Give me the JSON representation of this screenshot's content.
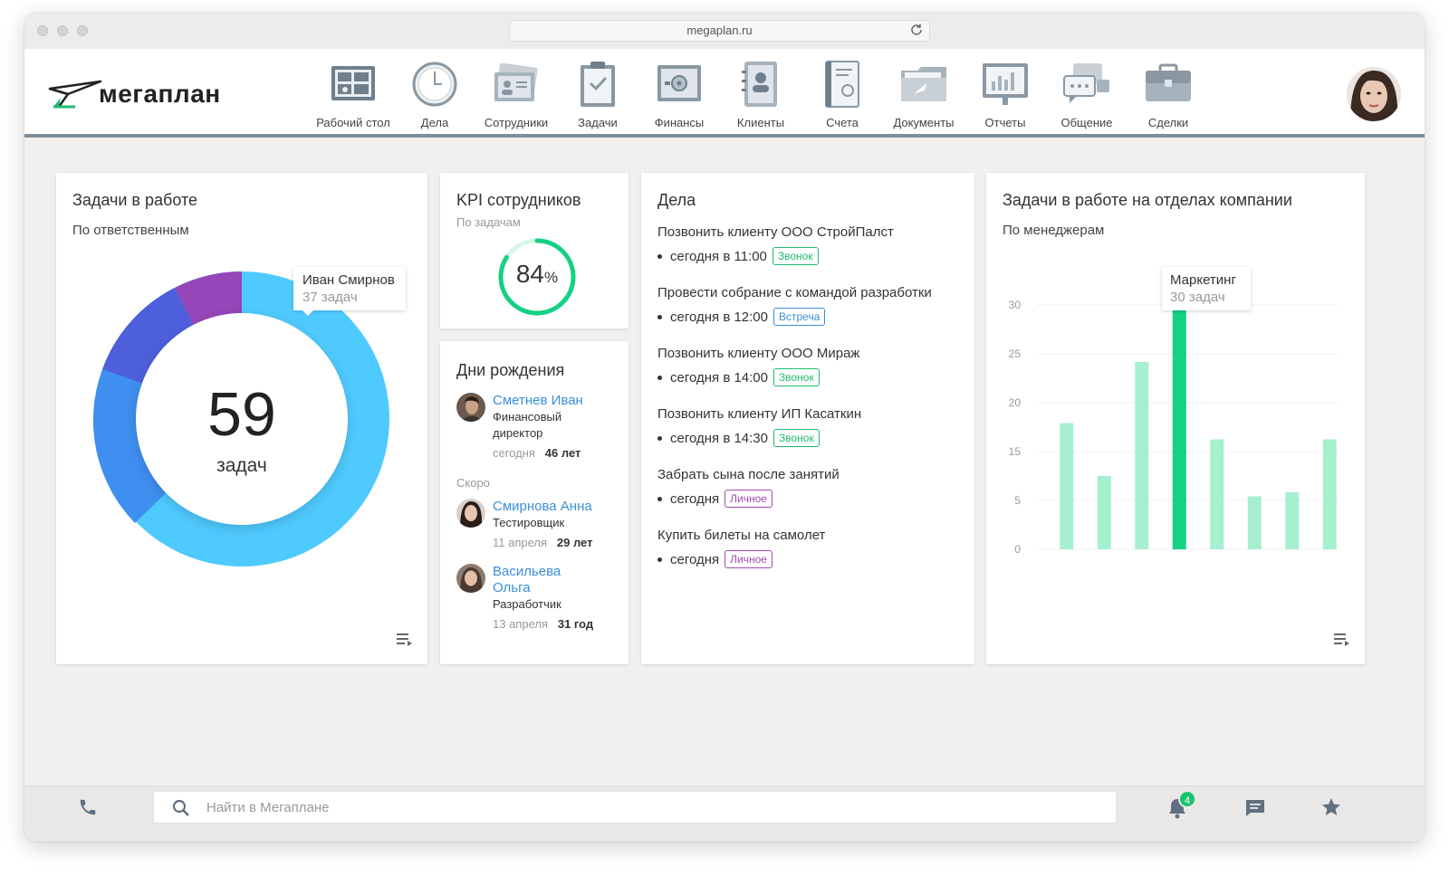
{
  "browser": {
    "url": "megaplan.ru"
  },
  "app": {
    "logo_text": "мегаплан",
    "nav": [
      {
        "label": "Рабочий стол",
        "icon": "desktop-icon"
      },
      {
        "label": "Дела",
        "icon": "clock-icon"
      },
      {
        "label": "Сотрудники",
        "icon": "employees-icon"
      },
      {
        "label": "Задачи",
        "icon": "clipboard-icon"
      },
      {
        "label": "Финансы",
        "icon": "safe-icon"
      },
      {
        "label": "Клиенты",
        "icon": "contacts-icon"
      },
      {
        "label": "Счета",
        "icon": "invoice-icon"
      },
      {
        "label": "Документы",
        "icon": "folder-icon"
      },
      {
        "label": "Отчеты",
        "icon": "report-icon"
      },
      {
        "label": "Общение",
        "icon": "chat-icon"
      },
      {
        "label": "Сделки",
        "icon": "briefcase-icon"
      }
    ]
  },
  "tasks_card": {
    "title": "Задачи в работе",
    "subtitle": "По ответственным",
    "total_value": "59",
    "total_unit": "задач",
    "tooltip_name": "Иван Смирнов",
    "tooltip_value": "37 задач",
    "segment_colors": [
      "#4fcaff",
      "#3f8ff0",
      "#4d5fdb",
      "#9546b8"
    ]
  },
  "kpi_card": {
    "title": "KPI сотрудников",
    "subtitle": "По задачам",
    "value": "84",
    "unit": "%",
    "fraction": 0.84
  },
  "birthdays": {
    "title": "Дни рождения",
    "soon_label": "Скоро",
    "people": [
      {
        "name": "Сметнев Иван",
        "role1": "Финансовый",
        "role2": "директор",
        "date": "сегодня",
        "age": "46 лет"
      },
      {
        "name": "Смирнова Анна",
        "role1": "Тестировщик",
        "role2": "",
        "date": "11 апреля",
        "age": "29 лет"
      },
      {
        "name": "Васильева",
        "name2": "Ольга",
        "role1": "Разработчик",
        "role2": "",
        "date": "13 апреля",
        "age": "31 год"
      }
    ]
  },
  "deals": {
    "title": "Дела",
    "items": [
      {
        "title": "Позвонить клиенту ООО СтройПалст",
        "time": "сегодня в 11:00",
        "tag": "Звонок",
        "tag_type": "green"
      },
      {
        "title": "Провести собрание с командой разработки",
        "time": "сегодня в 12:00",
        "tag": "Встреча",
        "tag_type": "blue"
      },
      {
        "title": "Позвонить клиенту ООО Мираж",
        "time": "сегодня в 14:00",
        "tag": "Звонок",
        "tag_type": "green"
      },
      {
        "title": "Позвонить клиенту ИП Касаткин",
        "time": "сегодня в 14:30",
        "tag": "Звонок",
        "tag_type": "green"
      },
      {
        "title": "Забрать сына после занятий",
        "time": "сегодня",
        "tag": "Личное",
        "tag_type": "purple"
      },
      {
        "title": "Купить билеты на самолет",
        "time": "сегодня",
        "tag": "Личное",
        "tag_type": "purple"
      }
    ]
  },
  "dept_card": {
    "title": "Задачи в работе на отделах компании",
    "subtitle": "По менеджерам",
    "tooltip_name": "Маркетинг",
    "tooltip_value": "30 задач"
  },
  "chart_data": {
    "type": "bar",
    "categories": [
      "",
      "",
      "",
      "",
      "",
      "",
      "",
      ""
    ],
    "values": [
      15.5,
      9,
      23,
      30,
      13.5,
      6.5,
      7,
      13.5
    ],
    "highlight_index": 3,
    "yticks": [
      0,
      5,
      15,
      20,
      25,
      30
    ],
    "ylim": [
      0,
      30
    ],
    "colors": {
      "bar": "#a6f0d0",
      "highlight": "#14d184"
    }
  },
  "footer": {
    "search_placeholder": "Найти в Мегаплане",
    "notifications_count": "4"
  }
}
